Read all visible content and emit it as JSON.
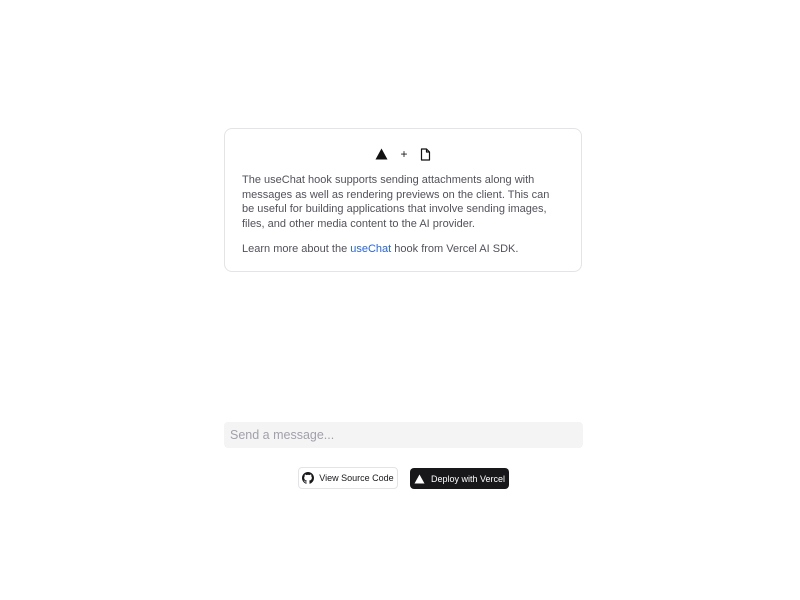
{
  "info_card": {
    "logo_separator": "+",
    "description": "The useChat hook supports sending attachments along with messages as well as rendering previews on the client. This can be useful for building applications that involve sending images, files, and other media content to the AI provider.",
    "learn_more": {
      "prefix": "Learn more about the ",
      "link_text": "useChat",
      "suffix": " hook from Vercel AI SDK."
    },
    "icons": [
      "vercel-triangle-icon",
      "file-icon"
    ]
  },
  "chat": {
    "input_placeholder": "Send a message...",
    "input_value": ""
  },
  "footer_buttons": {
    "source_label": "View Source Code",
    "source_icon": "github-icon",
    "deploy_label": "Deploy with Vercel",
    "deploy_icon": "vercel-triangle-icon"
  },
  "colors": {
    "link": "#2563eb",
    "deploy_bg": "#18181b",
    "input_bg": "#f4f4f5",
    "card_border": "#e4e4e7"
  }
}
